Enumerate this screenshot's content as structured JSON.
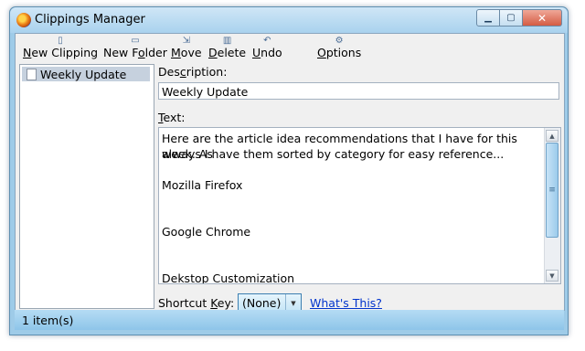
{
  "window": {
    "title": "Clippings Manager"
  },
  "toolbar": {
    "new_clipping": {
      "pre": "",
      "u": "N",
      "post": "ew Clipping"
    },
    "new_folder": {
      "pre": "New F",
      "u": "o",
      "post": "lder"
    },
    "move": {
      "pre": "",
      "u": "M",
      "post": "ove"
    },
    "delete": {
      "pre": "",
      "u": "D",
      "post": "elete"
    },
    "undo": {
      "pre": "",
      "u": "U",
      "post": "ndo"
    },
    "options": {
      "pre": "",
      "u": "O",
      "post": "ptions"
    }
  },
  "tree": {
    "items": [
      {
        "label": "Weekly Update",
        "selected": true
      }
    ]
  },
  "form": {
    "description_label": {
      "pre": "Des",
      "u": "c",
      "post": "ription:"
    },
    "description_value": "Weekly Update",
    "text_label": {
      "pre": "",
      "u": "T",
      "post": "ext:"
    },
    "text_lines": [
      "Here are the article idea recommendations that I have for this week. As",
      "always I have them sorted by category for easy reference...",
      "",
      "Mozilla Firefox",
      "",
      "",
      "Google Chrome",
      "",
      "",
      "Dekstop Customization"
    ],
    "shortcut_label": {
      "pre": "Shortcut ",
      "u": "K",
      "post": "ey:"
    },
    "shortcut_value": "(None)",
    "whats_this": "What's This?"
  },
  "status": {
    "text": "1 item(s)"
  },
  "colors": {
    "accent": "#9ecbe8",
    "selection": "#c6d1de",
    "link": "#0033cc"
  }
}
